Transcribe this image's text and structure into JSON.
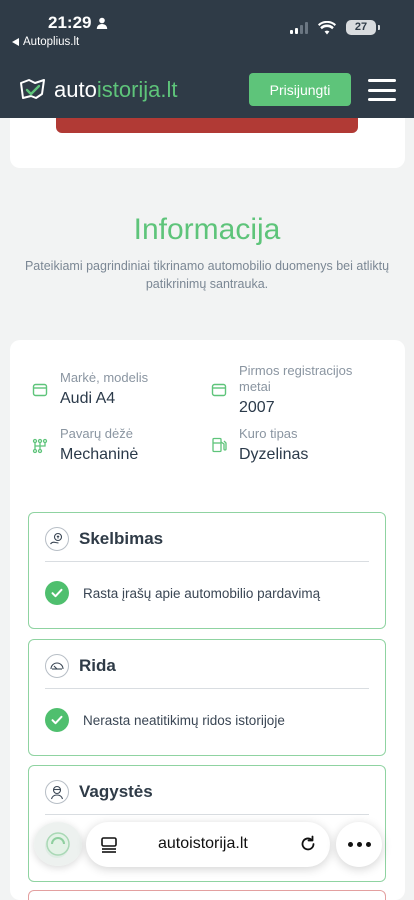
{
  "status_bar": {
    "time": "21:29",
    "back_label": "Autoplius.lt",
    "battery": "27"
  },
  "header": {
    "logo_part1": "auto",
    "logo_part2": "istorija.lt",
    "login_label": "Prisijungti"
  },
  "section": {
    "title": "Informacija",
    "subtitle": "Pateikiami pagrindiniai tikrinamo automobilio duomenys bei atliktų patikrinimų santrauka."
  },
  "vehicle": {
    "make_model": {
      "label": "Markė, modelis",
      "value": "Audi A4",
      "icon": "car-icon"
    },
    "first_registration": {
      "label": "Pirmos registracijos metai",
      "value": "2007",
      "icon": "calendar-icon"
    },
    "gearbox": {
      "label": "Pavarų dėžė",
      "value": "Mechaninė",
      "icon": "gearbox-icon"
    },
    "fuel": {
      "label": "Kuro tipas",
      "value": "Dyzelinas",
      "icon": "fuel-icon"
    }
  },
  "checks": [
    {
      "title": "Skelbimas",
      "result": "Rasta įrašų apie automobilio pardavimą",
      "icon": "listing-icon"
    },
    {
      "title": "Rida",
      "result": "Nerasta neatitikimų ridos istorijoje",
      "icon": "odometer-icon"
    },
    {
      "title": "Vagystės",
      "result": "",
      "icon": "thief-icon"
    }
  ],
  "browser": {
    "url": "autoistorija.lt"
  },
  "colors": {
    "brand_green": "#5ec47a",
    "header_bg": "#2f3b47",
    "alert_red": "#b13a35"
  }
}
